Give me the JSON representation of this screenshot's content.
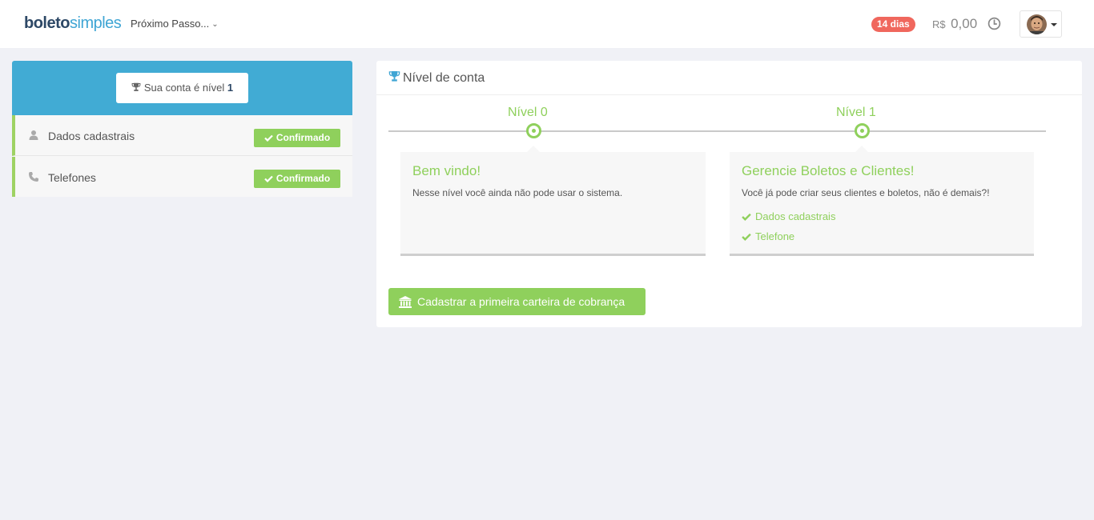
{
  "header": {
    "logo_part1": "boleto",
    "logo_part2": "simples",
    "next_step_label": "Próximo Passo...",
    "trial_badge": "14 dias",
    "balance_currency": "R$",
    "balance_amount": "0,00"
  },
  "sidebar": {
    "level_prefix": "Sua conta é nível",
    "level_number": "1",
    "items": [
      {
        "label": "Dados cadastrais",
        "status": "Confirmado",
        "icon": "user-icon"
      },
      {
        "label": "Telefones",
        "status": "Confirmado",
        "icon": "phone-icon"
      }
    ]
  },
  "main": {
    "title": "Nível de conta",
    "levels": [
      {
        "label": "Nível 0",
        "card_title": "Bem vindo!",
        "card_text": "Nesse nível você ainda não pode usar o sistema."
      },
      {
        "label": "Nível 1",
        "card_title": "Gerencie Boletos e Clientes!",
        "card_text": "Você já pode criar seus clientes e boletos, não é demais?!",
        "requirements": [
          "Dados cadastrais",
          "Telefone"
        ]
      }
    ],
    "cta_label": "Cadastrar a primeira carteira de cobrança"
  },
  "colors": {
    "accent_blue": "#41abd4",
    "success_green": "#8fd05c",
    "badge_red": "#f0675d",
    "background": "#f0f1f6"
  }
}
